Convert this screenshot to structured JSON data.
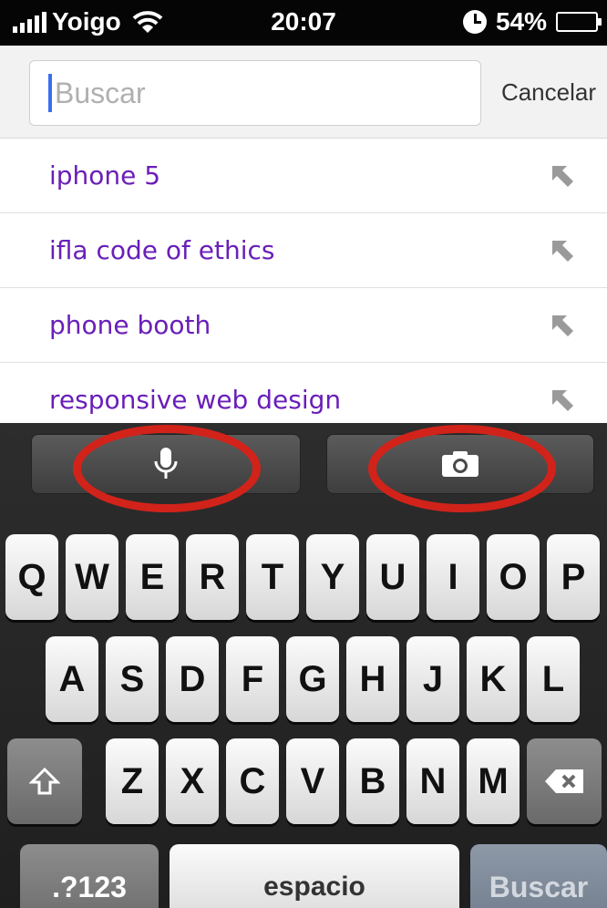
{
  "status_bar": {
    "carrier": "Yoigo",
    "time": "20:07",
    "battery": "54%",
    "battery_level": 0.54
  },
  "search": {
    "placeholder": "Buscar",
    "value": "",
    "cancel_label": "Cancelar"
  },
  "suggestions": [
    {
      "label": "iphone 5"
    },
    {
      "label": "ifla code of ethics"
    },
    {
      "label": "phone booth"
    },
    {
      "label": "responsive web design"
    }
  ],
  "keyboard": {
    "toolbar": {
      "mic_icon": "microphone-icon",
      "camera_icon": "camera-icon"
    },
    "row1": [
      "Q",
      "W",
      "E",
      "R",
      "T",
      "Y",
      "U",
      "I",
      "O",
      "P"
    ],
    "row2": [
      "A",
      "S",
      "D",
      "F",
      "G",
      "H",
      "J",
      "K",
      "L"
    ],
    "row3": [
      "Z",
      "X",
      "C",
      "V",
      "B",
      "N",
      "M"
    ],
    "symbols_label": ".?123",
    "space_label": "espacio",
    "go_label": "Buscar"
  },
  "colors": {
    "suggestion_text": "#6a1fb8",
    "annotation_ring": "#d1231a",
    "caret": "#3b6ff0"
  }
}
